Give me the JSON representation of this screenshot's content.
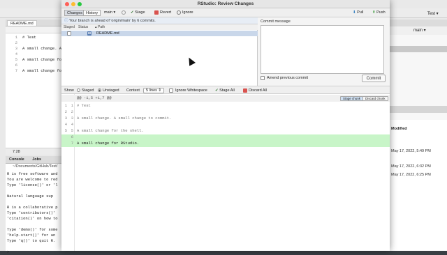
{
  "background": {
    "editor_tab": "README.md",
    "editor_lines": [
      {
        "n": "1",
        "t": "# Test"
      },
      {
        "n": "2",
        "t": ""
      },
      {
        "n": "3",
        "t": "A small change. A"
      },
      {
        "n": "4",
        "t": ""
      },
      {
        "n": "5",
        "t": "A small change fo"
      },
      {
        "n": "6",
        "t": ""
      },
      {
        "n": "7",
        "t": "A small change fo"
      }
    ],
    "cursor_pos": "7:28",
    "console_tab": "Console",
    "jobs_tab": "Jobs",
    "console_path": "~/Documents/GitHub/Test/",
    "console_lines": [
      "R is free software and",
      "You are welcome to red",
      "Type 'license()' or 'l",
      "",
      "  Natural language sup",
      "",
      "R is a collaborative p",
      "Type 'contributors()'",
      "'citation()' on how to",
      "",
      "Type 'demo()' for some",
      "'help.start()' for an",
      "Type 'q()' to quit R.",
      "",
      ">"
    ],
    "project": "Test",
    "branch": "main",
    "files_modified_header": "Modified",
    "file_dates": [
      "May 17, 2022, 5:49 PM",
      "May 17, 2022, 6:32 PM",
      "May 17, 2022, 6:25 PM"
    ]
  },
  "dialog": {
    "title": "RStudio: Review Changes",
    "toolbar": {
      "changes": "Changes",
      "history": "History",
      "branch": "main",
      "stage": "Stage",
      "revert": "Revert",
      "ignore": "Ignore",
      "pull": "Pull",
      "push": "Push"
    },
    "ahead_message": "Your branch is ahead of 'origin/main' by 6 commits.",
    "file_headers": {
      "staged": "Staged",
      "status": "Status",
      "path": "Path"
    },
    "files": [
      {
        "status": "M",
        "path": "README.md"
      }
    ],
    "commit_message_label": "Commit message",
    "amend_label": "Amend previous commit",
    "commit_button": "Commit",
    "show_bar": {
      "show": "Show",
      "staged": "Staged",
      "unstaged": "Unstaged",
      "context": "Context",
      "context_value": "5 lines",
      "ignore_whitespace": "Ignore Whitespace",
      "stage_all": "Stage All",
      "discard_all": "Discard All"
    },
    "hunk_header": "@@ -1,5 +1,7 @@",
    "stage_chunk": "Stage chunk",
    "discard_chunk": "Discard chunk",
    "diff_lines": [
      {
        "old": "1",
        "new": "1",
        "text": "# Test",
        "kind": "ctx"
      },
      {
        "old": "2",
        "new": "2",
        "text": "",
        "kind": "ctx"
      },
      {
        "old": "3",
        "new": "3",
        "text": "A small change. A small change to commit.",
        "kind": "ctx"
      },
      {
        "old": "4",
        "new": "4",
        "text": "",
        "kind": "ctx"
      },
      {
        "old": "5",
        "new": "5",
        "text": "A small change for the shell.",
        "kind": "ctx"
      },
      {
        "old": "",
        "new": "6",
        "text": "",
        "kind": "add"
      },
      {
        "old": "",
        "new": "7",
        "text": "A small change for RStudio.",
        "kind": "add"
      }
    ]
  },
  "colors": {
    "added_line": "#c8f5c8",
    "selected_row": "#c9d7ea",
    "close": "#fe5f57",
    "minimize": "#febc2e",
    "zoom": "#28c840"
  }
}
